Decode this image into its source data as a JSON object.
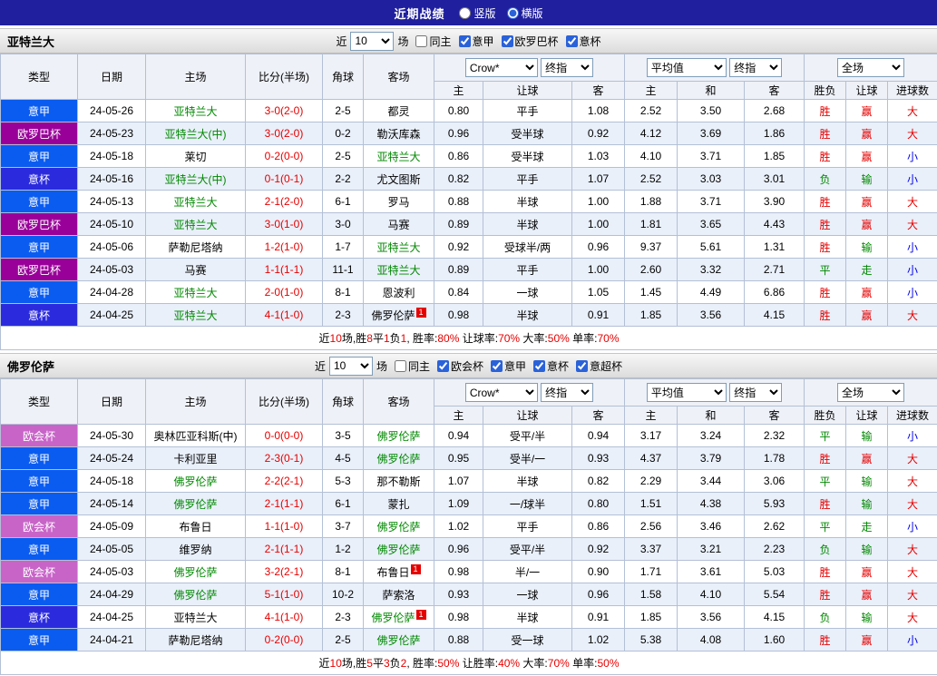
{
  "topbar": {
    "title": "近期战绩",
    "radios": [
      {
        "label": "竖版",
        "selected": false
      },
      {
        "label": "横版",
        "selected": true
      }
    ]
  },
  "columns": {
    "type": "类型",
    "date": "日期",
    "home": "主场",
    "score": "比分(半场)",
    "corner": "角球",
    "away": "客场",
    "group1_select1": "Crow*",
    "group1_select2": "终指",
    "group1_sub": [
      "主",
      "让球",
      "客"
    ],
    "group2_select1": "平均值",
    "group2_select2": "终指",
    "group2_sub": [
      "主",
      "和",
      "客"
    ],
    "group3_select": "全场",
    "group3_sub": [
      "胜负",
      "让球",
      "进球数"
    ]
  },
  "filter_labels": {
    "prefix": "近",
    "suffix": "场"
  },
  "colors": {
    "type_badges": {
      "意甲": "#0a5cf0",
      "欧罗巴杯": "#990099",
      "意杯": "#2b2bdd",
      "欧会杯": "#c864c8"
    },
    "results": {
      "胜": "#e60000",
      "平": "#008800",
      "负": "#008800",
      "赢": "#e60000",
      "走": "#008800",
      "输": "#008800",
      "大": "#e60000",
      "小": "#0000ee"
    },
    "team_highlight": "#008800",
    "accent_red": "#e60000"
  },
  "sections": [
    {
      "team": "亚特兰大",
      "match_count": "10",
      "checkboxes": [
        {
          "label": "同主",
          "checked": false
        },
        {
          "label": "意甲",
          "checked": true
        },
        {
          "label": "欧罗巴杯",
          "checked": true
        },
        {
          "label": "意杯",
          "checked": true
        }
      ],
      "rows": [
        {
          "type": "意甲",
          "date": "24-05-26",
          "home": "亚特兰大",
          "home_hl": true,
          "score": "3-0(2-0)",
          "corner": "2-5",
          "away": "都灵",
          "odds": [
            "0.80",
            "平手",
            "1.08",
            "2.52",
            "3.50",
            "2.68"
          ],
          "results": [
            "胜",
            "赢",
            "大"
          ]
        },
        {
          "type": "欧罗巴杯",
          "date": "24-05-23",
          "home": "亚特兰大(中)",
          "home_hl": true,
          "score": "3-0(2-0)",
          "corner": "0-2",
          "away": "勒沃库森",
          "odds": [
            "0.96",
            "受半球",
            "0.92",
            "4.12",
            "3.69",
            "1.86"
          ],
          "results": [
            "胜",
            "赢",
            "大"
          ]
        },
        {
          "type": "意甲",
          "date": "24-05-18",
          "home": "莱切",
          "score": "0-2(0-0)",
          "corner": "2-5",
          "away": "亚特兰大",
          "away_hl": true,
          "odds": [
            "0.86",
            "受半球",
            "1.03",
            "4.10",
            "3.71",
            "1.85"
          ],
          "results": [
            "胜",
            "赢",
            "小"
          ]
        },
        {
          "type": "意杯",
          "date": "24-05-16",
          "home": "亚特兰大(中)",
          "home_hl": true,
          "score": "0-1(0-1)",
          "corner": "2-2",
          "away": "尤文图斯",
          "odds": [
            "0.82",
            "平手",
            "1.07",
            "2.52",
            "3.03",
            "3.01"
          ],
          "results": [
            "负",
            "输",
            "小"
          ]
        },
        {
          "type": "意甲",
          "date": "24-05-13",
          "home": "亚特兰大",
          "home_hl": true,
          "score": "2-1(2-0)",
          "corner": "6-1",
          "away": "罗马",
          "odds": [
            "0.88",
            "半球",
            "1.00",
            "1.88",
            "3.71",
            "3.90"
          ],
          "results": [
            "胜",
            "赢",
            "大"
          ]
        },
        {
          "type": "欧罗巴杯",
          "date": "24-05-10",
          "home": "亚特兰大",
          "home_hl": true,
          "score": "3-0(1-0)",
          "corner": "3-0",
          "away": "马赛",
          "odds": [
            "0.89",
            "半球",
            "1.00",
            "1.81",
            "3.65",
            "4.43"
          ],
          "results": [
            "胜",
            "赢",
            "大"
          ]
        },
        {
          "type": "意甲",
          "date": "24-05-06",
          "home": "萨勒尼塔纳",
          "score": "1-2(1-0)",
          "corner": "1-7",
          "away": "亚特兰大",
          "away_hl": true,
          "odds": [
            "0.92",
            "受球半/两",
            "0.96",
            "9.37",
            "5.61",
            "1.31"
          ],
          "results": [
            "胜",
            "输",
            "小"
          ]
        },
        {
          "type": "欧罗巴杯",
          "date": "24-05-03",
          "home": "马赛",
          "score": "1-1(1-1)",
          "corner": "11-1",
          "away": "亚特兰大",
          "away_hl": true,
          "odds": [
            "0.89",
            "平手",
            "1.00",
            "2.60",
            "3.32",
            "2.71"
          ],
          "results": [
            "平",
            "走",
            "小"
          ]
        },
        {
          "type": "意甲",
          "date": "24-04-28",
          "home": "亚特兰大",
          "home_hl": true,
          "score": "2-0(1-0)",
          "corner": "8-1",
          "away": "恩波利",
          "odds": [
            "0.84",
            "一球",
            "1.05",
            "1.45",
            "4.49",
            "6.86"
          ],
          "results": [
            "胜",
            "赢",
            "小"
          ]
        },
        {
          "type": "意杯",
          "date": "24-04-25",
          "home": "亚特兰大",
          "home_hl": true,
          "score": "4-1(1-0)",
          "corner": "2-3",
          "away": "佛罗伦萨",
          "away_red": "1",
          "odds": [
            "0.98",
            "半球",
            "0.91",
            "1.85",
            "3.56",
            "4.15"
          ],
          "results": [
            "胜",
            "赢",
            "大"
          ]
        }
      ],
      "summary": [
        {
          "t": "近"
        },
        {
          "t": "10",
          "red": true
        },
        {
          "t": "场,胜"
        },
        {
          "t": "8",
          "red": true
        },
        {
          "t": "平"
        },
        {
          "t": "1",
          "red": true
        },
        {
          "t": "负"
        },
        {
          "t": "1",
          "red": true
        },
        {
          "t": ", 胜率:"
        },
        {
          "t": "80%",
          "red": true
        },
        {
          "t": " 让球率:"
        },
        {
          "t": "70%",
          "red": true
        },
        {
          "t": " 大率:"
        },
        {
          "t": "50%",
          "red": true
        },
        {
          "t": " 单率:"
        },
        {
          "t": "70%",
          "red": true
        }
      ]
    },
    {
      "team": "佛罗伦萨",
      "match_count": "10",
      "checkboxes": [
        {
          "label": "同主",
          "checked": false
        },
        {
          "label": "欧会杯",
          "checked": true
        },
        {
          "label": "意甲",
          "checked": true
        },
        {
          "label": "意杯",
          "checked": true
        },
        {
          "label": "意超杯",
          "checked": true
        }
      ],
      "rows": [
        {
          "type": "欧会杯",
          "date": "24-05-30",
          "home": "奥林匹亚科斯(中)",
          "score": "0-0(0-0)",
          "corner": "3-5",
          "away": "佛罗伦萨",
          "away_hl": true,
          "odds": [
            "0.94",
            "受平/半",
            "0.94",
            "3.17",
            "3.24",
            "2.32"
          ],
          "results": [
            "平",
            "输",
            "小"
          ]
        },
        {
          "type": "意甲",
          "date": "24-05-24",
          "home": "卡利亚里",
          "score": "2-3(0-1)",
          "corner": "4-5",
          "away": "佛罗伦萨",
          "away_hl": true,
          "odds": [
            "0.95",
            "受半/一",
            "0.93",
            "4.37",
            "3.79",
            "1.78"
          ],
          "results": [
            "胜",
            "赢",
            "大"
          ]
        },
        {
          "type": "意甲",
          "date": "24-05-18",
          "home": "佛罗伦萨",
          "home_hl": true,
          "score": "2-2(2-1)",
          "corner": "5-3",
          "away": "那不勒斯",
          "odds": [
            "1.07",
            "半球",
            "0.82",
            "2.29",
            "3.44",
            "3.06"
          ],
          "results": [
            "平",
            "输",
            "大"
          ]
        },
        {
          "type": "意甲",
          "date": "24-05-14",
          "home": "佛罗伦萨",
          "home_hl": true,
          "score": "2-1(1-1)",
          "corner": "6-1",
          "away": "蒙扎",
          "odds": [
            "1.09",
            "一/球半",
            "0.80",
            "1.51",
            "4.38",
            "5.93"
          ],
          "results": [
            "胜",
            "输",
            "大"
          ]
        },
        {
          "type": "欧会杯",
          "date": "24-05-09",
          "home": "布鲁日",
          "score": "1-1(1-0)",
          "corner": "3-7",
          "away": "佛罗伦萨",
          "away_hl": true,
          "odds": [
            "1.02",
            "平手",
            "0.86",
            "2.56",
            "3.46",
            "2.62"
          ],
          "results": [
            "平",
            "走",
            "小"
          ]
        },
        {
          "type": "意甲",
          "date": "24-05-05",
          "home": "维罗纳",
          "score": "2-1(1-1)",
          "corner": "1-2",
          "away": "佛罗伦萨",
          "away_hl": true,
          "odds": [
            "0.96",
            "受平/半",
            "0.92",
            "3.37",
            "3.21",
            "2.23"
          ],
          "results": [
            "负",
            "输",
            "大"
          ]
        },
        {
          "type": "欧会杯",
          "date": "24-05-03",
          "home": "佛罗伦萨",
          "home_hl": true,
          "score": "3-2(2-1)",
          "corner": "8-1",
          "away": "布鲁日",
          "away_red": "1",
          "odds": [
            "0.98",
            "半/一",
            "0.90",
            "1.71",
            "3.61",
            "5.03"
          ],
          "results": [
            "胜",
            "赢",
            "大"
          ]
        },
        {
          "type": "意甲",
          "date": "24-04-29",
          "home": "佛罗伦萨",
          "home_hl": true,
          "score": "5-1(1-0)",
          "corner": "10-2",
          "away": "萨索洛",
          "odds": [
            "0.93",
            "一球",
            "0.96",
            "1.58",
            "4.10",
            "5.54"
          ],
          "results": [
            "胜",
            "赢",
            "大"
          ]
        },
        {
          "type": "意杯",
          "date": "24-04-25",
          "home": "亚特兰大",
          "score": "4-1(1-0)",
          "corner": "2-3",
          "away": "佛罗伦萨",
          "away_hl": true,
          "away_red": "1",
          "odds": [
            "0.98",
            "半球",
            "0.91",
            "1.85",
            "3.56",
            "4.15"
          ],
          "results": [
            "负",
            "输",
            "大"
          ]
        },
        {
          "type": "意甲",
          "date": "24-04-21",
          "home": "萨勒尼塔纳",
          "score": "0-2(0-0)",
          "corner": "2-5",
          "away": "佛罗伦萨",
          "away_hl": true,
          "odds": [
            "0.88",
            "受一球",
            "1.02",
            "5.38",
            "4.08",
            "1.60"
          ],
          "results": [
            "胜",
            "赢",
            "小"
          ]
        }
      ],
      "summary": [
        {
          "t": "近"
        },
        {
          "t": "10",
          "red": true
        },
        {
          "t": "场,胜"
        },
        {
          "t": "5",
          "red": true
        },
        {
          "t": "平"
        },
        {
          "t": "3",
          "red": true
        },
        {
          "t": "负"
        },
        {
          "t": "2",
          "red": true
        },
        {
          "t": ", 胜率:"
        },
        {
          "t": "50%",
          "red": true
        },
        {
          "t": " 让胜率:"
        },
        {
          "t": "40%",
          "red": true
        },
        {
          "t": " 大率:"
        },
        {
          "t": "70%",
          "red": true
        },
        {
          "t": " 单率:"
        },
        {
          "t": "50%",
          "red": true
        }
      ]
    }
  ]
}
